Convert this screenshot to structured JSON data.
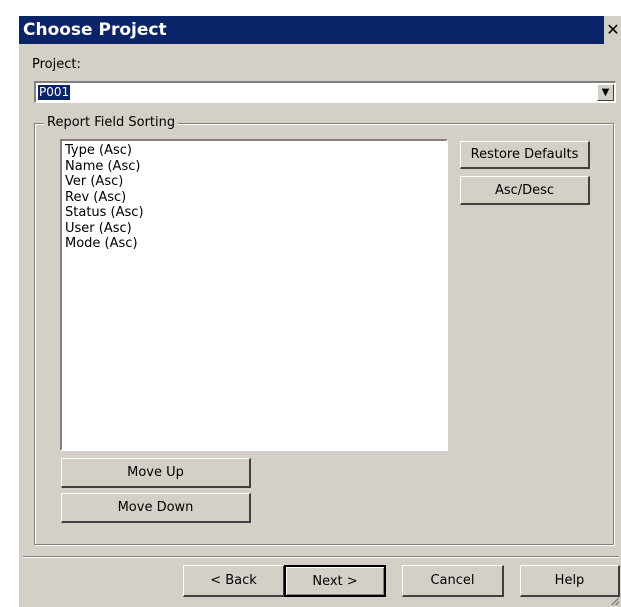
{
  "window": {
    "title": "Choose Project",
    "close_glyph": "✕"
  },
  "project": {
    "label": "Project:",
    "selected_value": "P001",
    "dropdown_glyph": "▼"
  },
  "sorting": {
    "group_label": "Report Field Sorting",
    "fields": [
      "Type (Asc)",
      "Name (Asc)",
      "Ver (Asc)",
      "Rev (Asc)",
      "Status (Asc)",
      "User (Asc)",
      "Mode (Asc)"
    ],
    "restore_defaults_label": "Restore Defaults",
    "asc_desc_label": "Asc/Desc",
    "move_up_label": "Move Up",
    "move_down_label": "Move Down"
  },
  "footer": {
    "back_label": "< Back",
    "next_label": "Next >",
    "cancel_label": "Cancel",
    "help_label": "Help"
  }
}
